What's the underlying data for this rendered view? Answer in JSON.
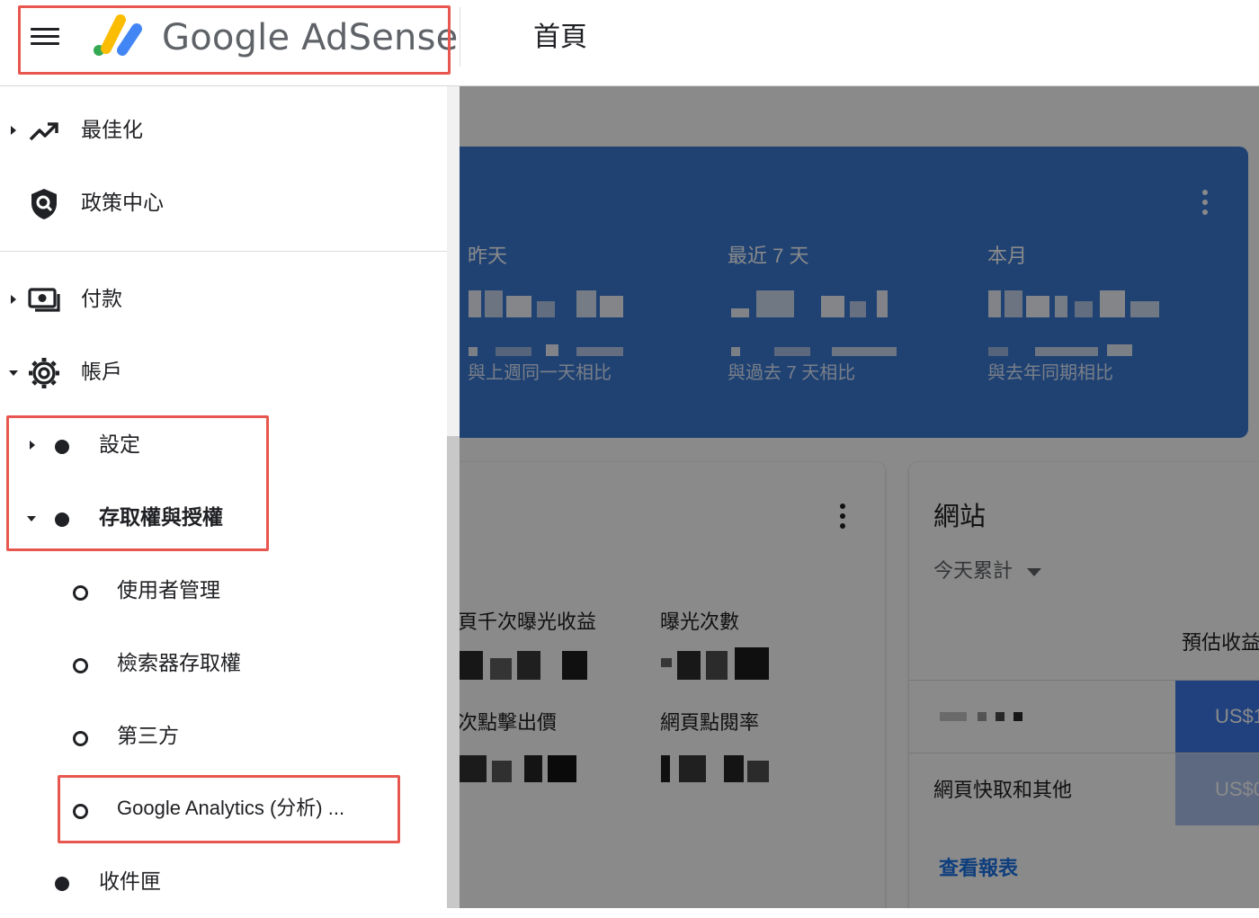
{
  "header": {
    "brand": "Google AdSense",
    "page_title": "首頁"
  },
  "sidebar": {
    "items": [
      {
        "label": "最佳化",
        "icon": "trending-up-icon"
      },
      {
        "label": "政策中心",
        "icon": "policy-shield-icon"
      },
      {
        "label": "付款",
        "icon": "payments-icon"
      },
      {
        "label": "帳戶",
        "icon": "gear-icon"
      }
    ],
    "account_children": [
      {
        "label": "設定"
      },
      {
        "label": "存取權與授權"
      }
    ],
    "access_children": [
      {
        "label": "使用者管理"
      },
      {
        "label": "檢索器存取權"
      },
      {
        "label": "第三方"
      },
      {
        "label": "Google Analytics (分析) ..."
      }
    ],
    "inbox": {
      "label": "收件匣"
    }
  },
  "earnings": {
    "yesterday_label": "昨天",
    "yesterday_compare": "與上週同一天相比",
    "last7_label": "最近 7 天",
    "last7_compare": "與過去 7 天相比",
    "month_label": "本月",
    "month_compare": "與去年同期相比"
  },
  "metrics": {
    "page_rpm_label": "頁千次曝光收益",
    "impressions_label": "曝光次數",
    "cpc_label": "次點擊出價",
    "page_ctr_label": "網頁點閱率"
  },
  "sites": {
    "title": "網站",
    "range": "今天累計",
    "column": "預估收益",
    "row1_value": "US$1",
    "row2_label": "網頁快取和其他",
    "row2_value": "US$0",
    "link": "查看報表"
  },
  "colors": {
    "brand_yellow": "#fbbc04",
    "brand_blue": "#4285f4",
    "brand_green": "#34a853",
    "card_blue": "#3a7bd5",
    "highlight_red": "#e8574f",
    "link_blue": "#1a73e8"
  }
}
